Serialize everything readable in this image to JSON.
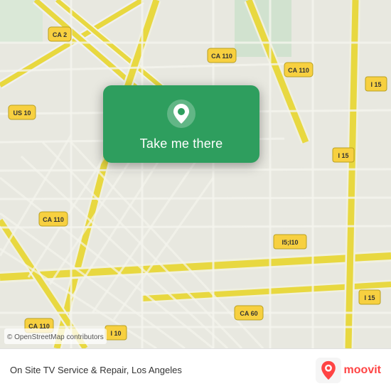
{
  "map": {
    "attribution": "© OpenStreetMap contributors",
    "location_name": "On Site TV Service & Repair",
    "city": "Los Angeles",
    "background_color": "#e8e8e0"
  },
  "card": {
    "button_label": "Take me there",
    "icon": "location-pin"
  },
  "bottom_bar": {
    "business_label": "On Site TV Service & Repair, Los Angeles",
    "logo_name": "moovit-logo"
  }
}
